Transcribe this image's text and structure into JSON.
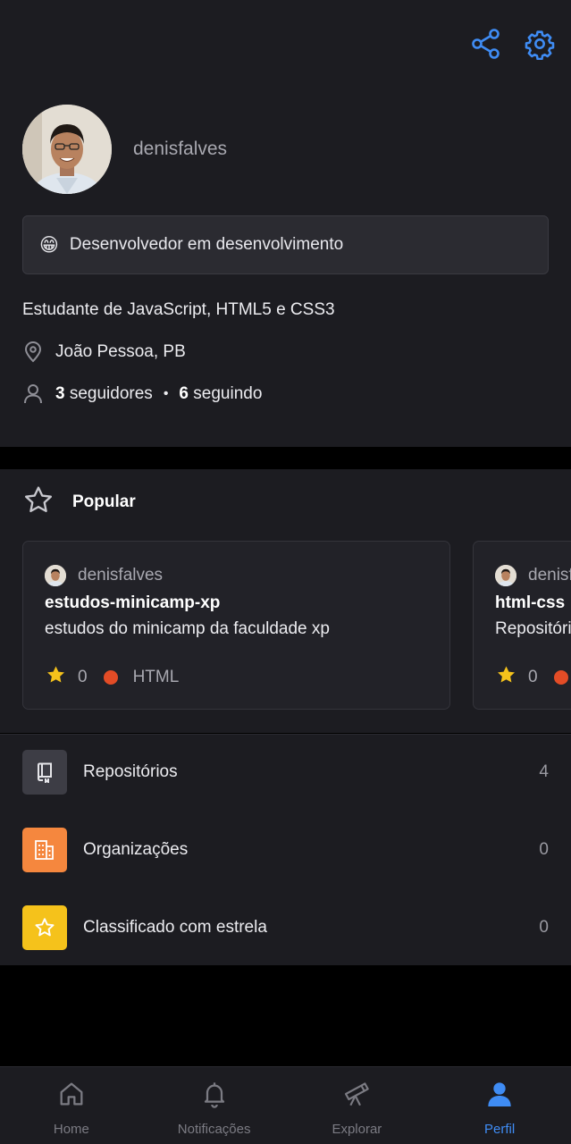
{
  "profile": {
    "username": "denisfalves",
    "status_emoji": "😁",
    "status_text": "Desenvolvedor em desenvolvimento",
    "bio": "Estudante de JavaScript, HTML5 e CSS3",
    "location": "João Pessoa, PB",
    "followers_count": "3",
    "followers_label": "seguidores",
    "following_count": "6",
    "following_label": "seguindo",
    "separator": "•"
  },
  "popular": {
    "title": "Popular",
    "cards": [
      {
        "owner": "denisfalves",
        "repo": "estudos-minicamp-xp",
        "description": "estudos do minicamp da faculdade xp",
        "stars": "0",
        "language": "HTML",
        "language_color": "#e34c26"
      },
      {
        "owner": "denisfalves",
        "repo": "html-css",
        "description": "Repositório",
        "stars": "0",
        "language": "",
        "language_color": "#e34c26"
      }
    ]
  },
  "menu": [
    {
      "label": "Repositórios",
      "count": "4",
      "icon": "repo-icon",
      "color": "#3d3d45"
    },
    {
      "label": "Organizações",
      "count": "0",
      "icon": "organization-icon",
      "color": "#f5873e"
    },
    {
      "label": "Classificado com estrela",
      "count": "0",
      "icon": "star-icon",
      "color": "#f5c21b"
    }
  ],
  "tabs": [
    {
      "label": "Home",
      "icon": "home-icon",
      "active": false
    },
    {
      "label": "Notificações",
      "icon": "bell-icon",
      "active": false
    },
    {
      "label": "Explorar",
      "icon": "telescope-icon",
      "active": false
    },
    {
      "label": "Perfil",
      "icon": "person-icon",
      "active": true
    }
  ],
  "colors": {
    "accent": "#3f8cf4",
    "background": "#1c1c21",
    "star": "#f5c21b"
  }
}
